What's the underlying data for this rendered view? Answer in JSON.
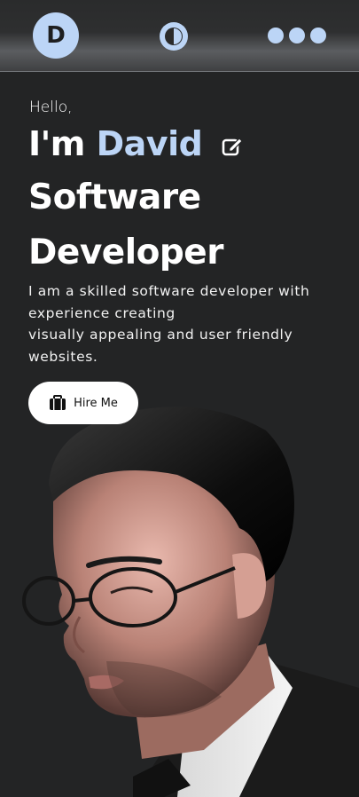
{
  "header": {
    "logo_letter": "D",
    "icons": {
      "theme": "theme-toggle-icon",
      "more": "more-dots-icon"
    }
  },
  "hero": {
    "greeting": "Hello,",
    "intro_prefix": "I'm",
    "name": "David",
    "role_line1": "Software",
    "role_line2": "Developer",
    "description_line1": "I am a skilled software developer with experience creating",
    "description_line2": "visually appealing and user friendly websites.",
    "cta_label": "Hire Me"
  },
  "colors": {
    "accent": "#bcd5f6",
    "background": "#232425",
    "button_bg": "#ffffff"
  }
}
